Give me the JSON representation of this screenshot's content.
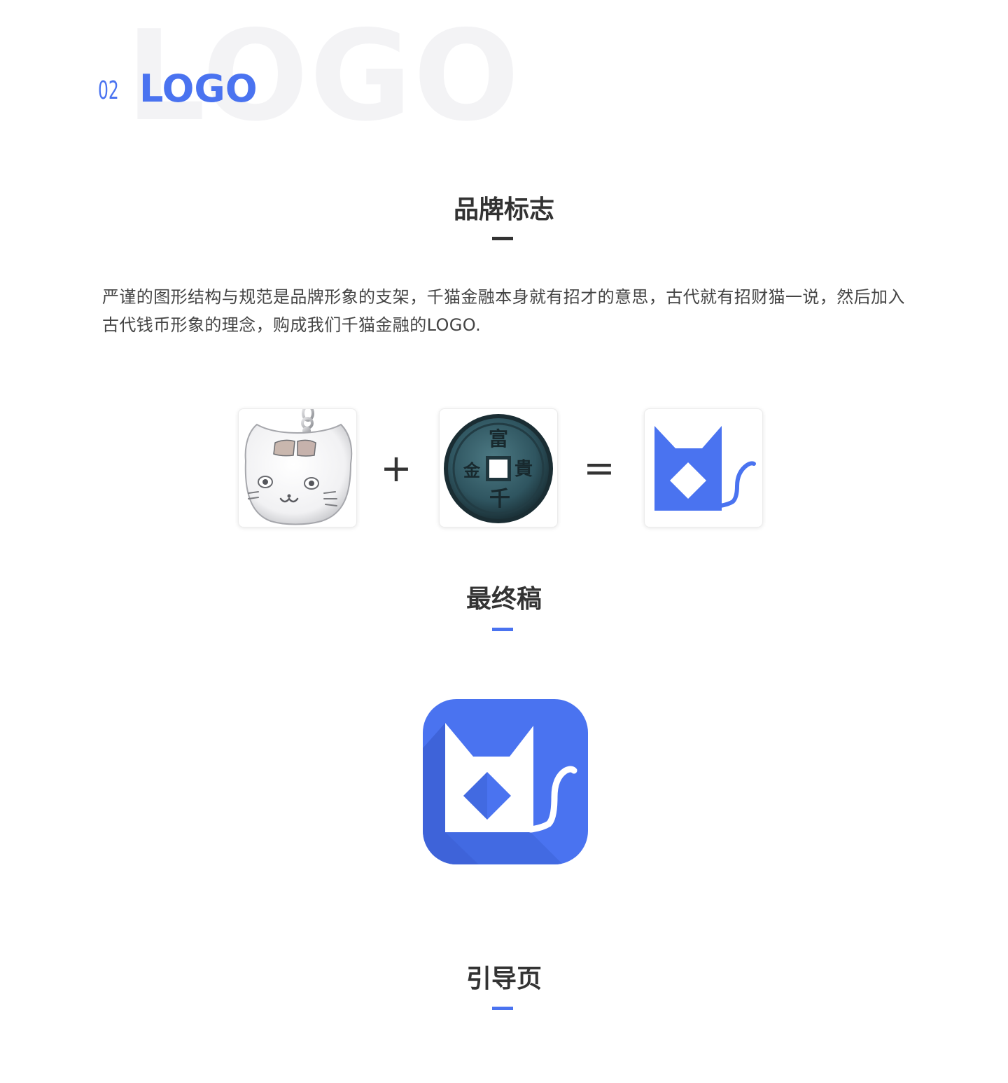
{
  "header": {
    "watermark": "LOGO",
    "section_number": "02",
    "section_title": "LOGO"
  },
  "brand_mark": {
    "heading": "品牌标志",
    "description": "严谨的图形结构与规范是品牌形象的支架，千猫金融本身就有招才的意思，古代就有招财猫一说，然后加入古代钱币形象的理念，购成我们千猫金融的LOGO."
  },
  "equation": {
    "items": [
      {
        "icon": "lucky-cat-pendant-image"
      },
      {
        "icon": "ancient-coin-image"
      },
      {
        "icon": "cat-logo-mark"
      }
    ],
    "operators": {
      "plus": "+",
      "equals": "="
    },
    "coin_characters": [
      "富",
      "貴",
      "千",
      "金"
    ]
  },
  "final": {
    "heading": "最终稿",
    "icon": "cat-app-icon"
  },
  "guide": {
    "heading": "引导页"
  },
  "colors": {
    "accent": "#4a73f0",
    "heading_bar_dark": "#333333",
    "heading_text": "#333333",
    "watermark": "#f3f3f5"
  }
}
